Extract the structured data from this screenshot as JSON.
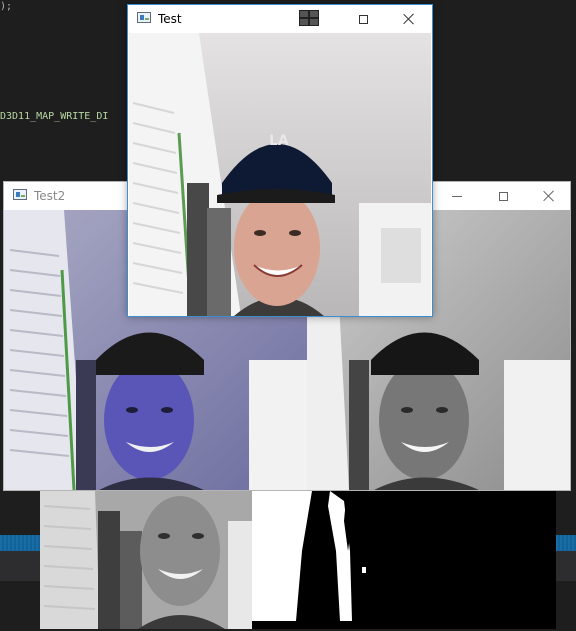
{
  "ide": {
    "code_line_1": ");",
    "code_line_2": "D3D11_MAP_WRITE_DI"
  },
  "window_test": {
    "title": "Test",
    "controls": {
      "minimize": "minimize",
      "maximize": "maximize",
      "close": "close"
    },
    "tray_icon": "network-icon"
  },
  "window_test2": {
    "title": "Test2",
    "controls": {
      "minimize": "minimize",
      "maximize": "maximize",
      "close": "close"
    }
  },
  "panels": {
    "grayscale_preview": "grayscale-camera-frame",
    "mask_preview": "binary-mask-frame"
  },
  "colors": {
    "ide_background": "#1e1e1e",
    "ide_status_blue": "#0e639c",
    "active_window_border": "#3c8ed1",
    "inactive_title_text": "#8a8a8a",
    "blue_tint_frame": "#4a4a9e"
  }
}
